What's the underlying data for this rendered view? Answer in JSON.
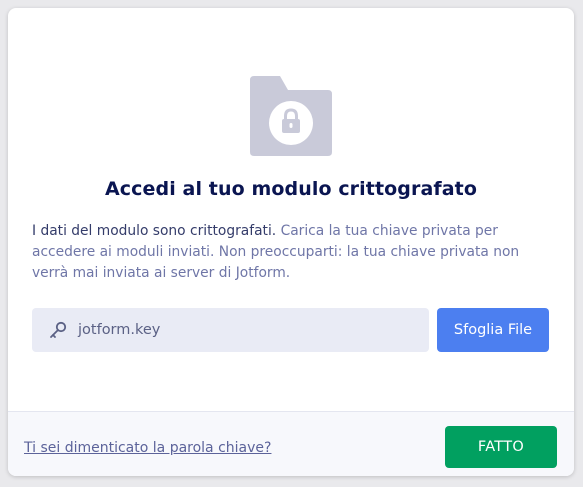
{
  "dialog": {
    "title": "Accedi al tuo modulo crittografato",
    "description_lead": "I dati del modulo sono crittografati.",
    "description_rest": " Carica la tua chiave privata per accedere ai moduli inviati. Non preoccuparti: la tua chiave privata non verrà mai inviata ai server di Jotform.",
    "folder_icon": "folder-lock-icon",
    "key_input": {
      "value": "jotform.key",
      "icon": "key-icon"
    },
    "browse_button_label": "Sfoglia File"
  },
  "footer": {
    "forgot_link_label": "Ti sei dimenticato la parola chiave?",
    "done_button_label": "FATTO"
  },
  "colors": {
    "primary_blue": "#4c7ff0",
    "done_green": "#01a060",
    "title": "#0a1551",
    "muted_text": "#6f76a7",
    "icon_gray": "#c9cad9"
  }
}
